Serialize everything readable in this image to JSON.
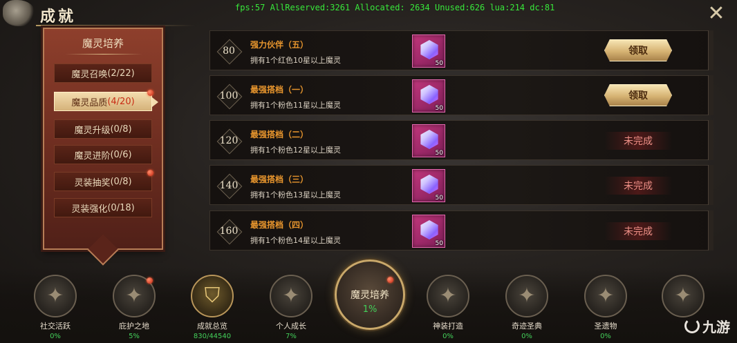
{
  "header": {
    "title": "成就",
    "debug": "fps:57 AllReserved:3261 Allocated: 2634 Unused:626 lua:214 dc:81",
    "close_icon": "close-x-icon"
  },
  "category_panel": {
    "title": "魔灵培养",
    "items": [
      {
        "label": "魔灵召唤",
        "count": "(2/22)",
        "active": false,
        "dot": false
      },
      {
        "label": "魔灵品质",
        "count": "(4/20)",
        "active": true,
        "dot": true
      },
      {
        "label": "魔灵升级",
        "count": "(0/8)",
        "active": false,
        "dot": false
      },
      {
        "label": "魔灵进阶",
        "count": "(0/6)",
        "active": false,
        "dot": false
      },
      {
        "label": "灵装抽奖",
        "count": "(0/8)",
        "active": false,
        "dot": true
      },
      {
        "label": "灵装强化",
        "count": "(0/18)",
        "active": false,
        "dot": false
      }
    ]
  },
  "achievements": [
    {
      "points": "80",
      "title": "强力伙伴（五）",
      "desc": "拥有1个红色10星以上魔灵",
      "reward_qty": "50",
      "action": "领取",
      "claimable": true
    },
    {
      "points": "100",
      "title": "最强搭档（一）",
      "desc": "拥有1个粉色11星以上魔灵",
      "reward_qty": "50",
      "action": "领取",
      "claimable": true
    },
    {
      "points": "120",
      "title": "最强搭档（二）",
      "desc": "拥有1个粉色12星以上魔灵",
      "reward_qty": "50",
      "action": "未完成",
      "claimable": false
    },
    {
      "points": "140",
      "title": "最强搭档（三）",
      "desc": "拥有1个粉色13星以上魔灵",
      "reward_qty": "50",
      "action": "未完成",
      "claimable": false
    },
    {
      "points": "160",
      "title": "最强搭档（四）",
      "desc": "拥有1个粉色14星以上魔灵",
      "reward_qty": "50",
      "action": "未完成",
      "claimable": false
    }
  ],
  "bottom_nav": {
    "items": [
      {
        "label": "社交活跃",
        "pct": "0%",
        "icon": "star-medal-icon"
      },
      {
        "label": "庇护之地",
        "pct": "5%",
        "icon": "star-medal-icon"
      },
      {
        "label": "成就总览",
        "pct": "830/44540",
        "icon": "shield-medal-icon"
      },
      {
        "label": "个人成长",
        "pct": "7%",
        "icon": "star-medal-icon"
      },
      {
        "label": "神装打造",
        "pct": "0%",
        "icon": "star-medal-icon"
      },
      {
        "label": "奇迹圣典",
        "pct": "0%",
        "icon": "star-medal-icon"
      },
      {
        "label": "圣遗物",
        "pct": "0%",
        "icon": "star-medal-icon"
      }
    ],
    "center": {
      "label": "魔灵培养",
      "pct": "1%"
    }
  },
  "watermark": "九游"
}
